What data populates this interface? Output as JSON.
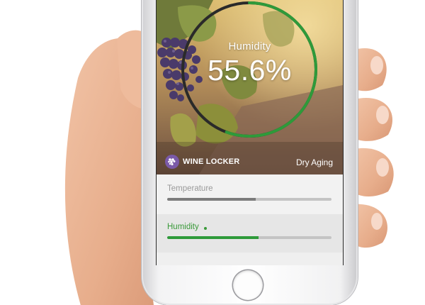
{
  "gauge": {
    "label": "Humidity",
    "value": "55.6%",
    "level": 0.556,
    "color": "#2e9a3a"
  },
  "brand": {
    "name": "WINE LOCKER",
    "icon": "grapes-icon",
    "color": "#7a5aa8"
  },
  "mode": "Dry Aging",
  "metrics": [
    {
      "label": "Temperature",
      "level": 0.54,
      "color": "#7c7c7c",
      "selected": false
    },
    {
      "label": "Humidity",
      "level": 0.556,
      "color": "#2e9a3a",
      "selected": true
    }
  ],
  "device": {
    "home_button": "home-button-icon"
  }
}
